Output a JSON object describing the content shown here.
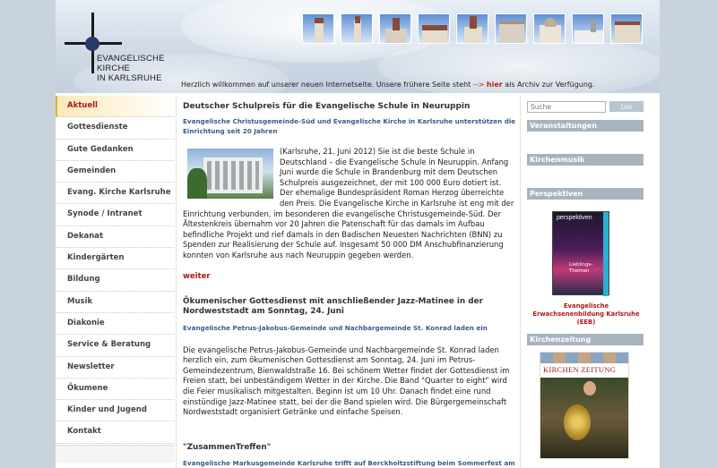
{
  "header": {
    "logo_line1": "EVANGELISCHE KIRCHE",
    "logo_line2": "IN KARLSRUHE",
    "welcome_prefix": "Herzlich willkommen auf unserer neuen Internetseite. Unsere frühere Seite steht",
    "welcome_arrow": "-->",
    "welcome_link": "hier",
    "welcome_suffix": "als Archiv zur Verfügung."
  },
  "nav": {
    "items": [
      "Aktuell",
      "Gottesdienste",
      "Gute Gedanken",
      "Gemeinden",
      "Evang. Kirche Karlsruhe",
      "Synode / Intranet",
      "Dekanat",
      "Kindergärten",
      "Bildung",
      "Musik",
      "Diakonie",
      "Service & Beratung",
      "Newsletter",
      "Ökumene",
      "Kinder und Jugend",
      "Kontakt"
    ],
    "active_index": 0
  },
  "article1": {
    "title": "Deutscher Schulpreis für die Evangelische Schule in Neuruppin",
    "subtitle": "Evangelische Christusgemeinde-Süd und Evangelische Kirche in Karlsruhe unterstützen die Einrichtung seit 20 Jahren",
    "body": "(Karlsruhe, 21. Juni 2012) Sie ist die beste Schule in Deutschland – die Evangelische Schule in Neuruppin. Anfang Juni wurde die Schule in Brandenburg mit dem Deutschen Schulpreis ausgezeichnet, der mit 100 000 Euro dotiert ist. Der ehemalige Bundespräsident Roman Herzog überreichte den Preis. Die Evangelische Kirche in Karlsruhe ist eng mit der Einrichtung verbunden, im besonderen die evangelische Christusgemeinde-Süd. Der Ältestenkreis übernahm vor 20 Jahren die Patenschaft für das damals im Aufbau befindliche Projekt und rief damals in den Badischen Neuesten Nachrichten (BNN) zu Spenden zur Realisierung der Schule auf. Insgesamt 50 000 DM Anschubfinanzierung konnten von Karlsruhe aus nach Neuruppin gegeben werden.",
    "more": "weiter"
  },
  "article2": {
    "title": "Ökumenischer Gottesdienst mit anschließender Jazz-Matinee in der Nordweststadt am Sonntag, 24. Juni",
    "subtitle": "Evangelische Petrus-Jakobus-Gemeinde und Nachbargemeinde St. Konrad laden ein",
    "body": "Die evangelische Petrus-Jakobus-Gemeinde und Nachbargemeinde St. Konrad laden herzlich ein, zum ökumenischen Gottesdienst am Sonntag, 24. Juni im Petrus-Gemeindezentrum, Bienwaldstraße 16. Bei schönem Wetter findet der Gottesdienst im Freien statt, bei unbeständigem Wetter in der Kirche. Die Band \"Quarter to eight\" wird die Feier musikalisch mitgestalten. Beginn ist um 10 Uhr. Danach findet eine rund einstündige Jazz-Matinee statt, bei der die Band spielen wird. Die Bürgergemeinschaft Nordweststadt organisiert Getränke und einfache Speisen."
  },
  "article3": {
    "title": "\"ZusammenTreffen\"",
    "subtitle": "Evangelische Markusgemeinde Karlsruhe trifft auf Berckholtzstiftung beim Sommerfest am"
  },
  "sidebar": {
    "search_placeholder": "Suche",
    "search_button": "Los",
    "box1": "Veranstaltungen",
    "box2": "Kirchenmusik",
    "box3": "Perspektiven",
    "magazine_title": "perspektiven",
    "magazine_sub": "Lieblings-Themen",
    "eeb_caption": "Evangelische Erwachsenenbildung Karlsruhe (EEB)",
    "box4": "Kirchenzeitung",
    "kz_title": "KIRCHEN ZEITUNG"
  }
}
